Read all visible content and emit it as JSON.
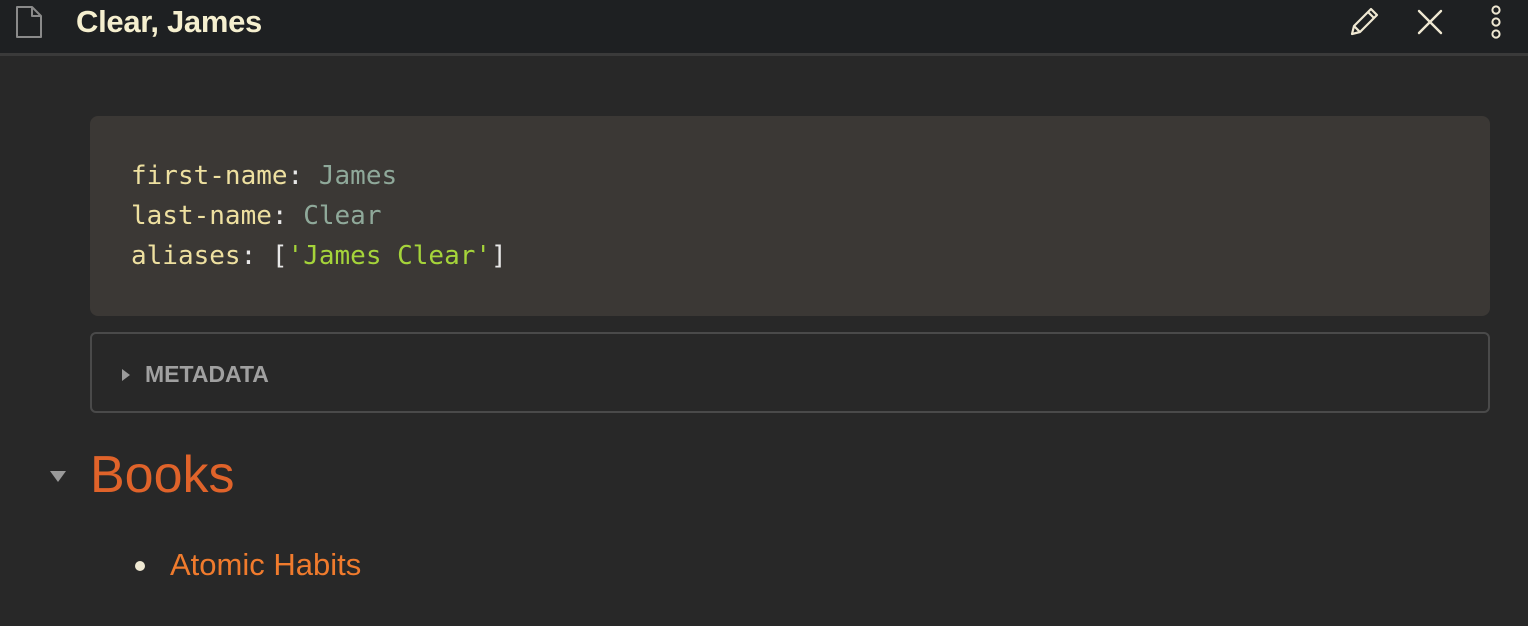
{
  "header": {
    "title": "Clear, James",
    "file_icon": "file-icon",
    "actions": [
      {
        "name": "edit",
        "icon": "pencil-icon"
      },
      {
        "name": "close",
        "icon": "close-icon"
      },
      {
        "name": "more",
        "icon": "more-vertical-icon"
      }
    ]
  },
  "frontmatter": {
    "lines": [
      {
        "key": "first-name",
        "sep": ": ",
        "value": "James"
      },
      {
        "key": "last-name",
        "sep": ": ",
        "value": "Clear"
      },
      {
        "key": "aliases",
        "sep": ": ",
        "open": "[",
        "string": "'James Clear'",
        "close": "]"
      }
    ]
  },
  "metadata": {
    "label": "METADATA"
  },
  "section": {
    "heading": "Books",
    "items": [
      {
        "label": "Atomic Habits"
      }
    ]
  },
  "colors": {
    "background": "#282828",
    "header_bg": "#1e2022",
    "title": "#f5efcf",
    "heading": "#e0632a",
    "link": "#f07b2d",
    "code_bg": "#3b3835",
    "code_key": "#eee0a0",
    "code_value": "#8fa99a",
    "code_string": "#a5d43a"
  }
}
